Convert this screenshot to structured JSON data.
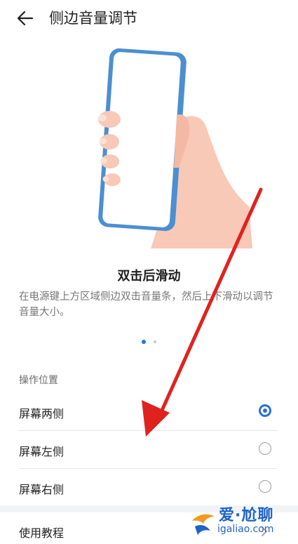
{
  "header": {
    "title": "侧边音量调节"
  },
  "illustration": {
    "name": "phone-hand-illustration"
  },
  "feature": {
    "title": "双击后滑动",
    "description": "在电源键上方区域侧边双击音量条，然后上下滑动以调节音量大小。"
  },
  "pager": {
    "current": 1,
    "total": 2
  },
  "position": {
    "section_label": "操作位置",
    "options": [
      {
        "label": "屏幕两侧",
        "selected": true
      },
      {
        "label": "屏幕左侧",
        "selected": false
      },
      {
        "label": "屏幕右侧",
        "selected": false
      }
    ]
  },
  "tutorial": {
    "label": "使用教程"
  },
  "watermark": {
    "line1": "爱·尬聊",
    "line2": "igaliao.com"
  },
  "colors": {
    "accent": "#2a6fd8",
    "annotation_arrow": "#e0221e"
  }
}
